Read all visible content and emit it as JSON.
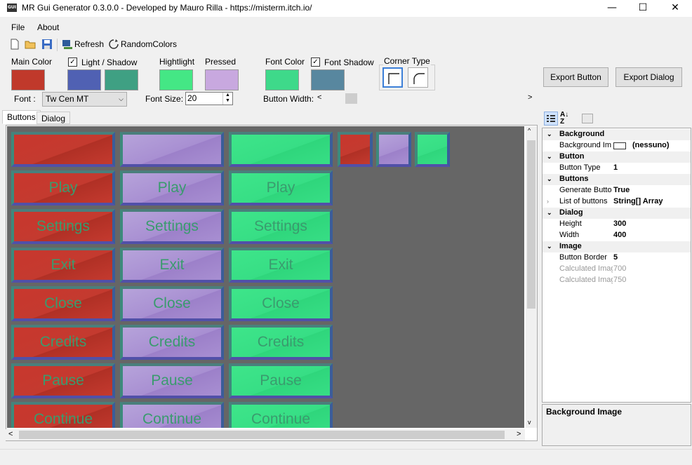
{
  "window": {
    "title": "MR Gui Generator 0.3.0.0 - Developed by Mauro Rilla - https://misterm.itch.io/",
    "app_icon_text": "GUI",
    "minimize": "—",
    "maximize": "☐",
    "close": "✕"
  },
  "menu": {
    "file": "File",
    "about": "About"
  },
  "toolbar": {
    "refresh": "Refresh",
    "random_colors": "RandomColors"
  },
  "options": {
    "main_color_label": "Main Color",
    "light_shadow_label": "Light / Shadow",
    "highlight_label": "Hightlight",
    "pressed_label": "Pressed",
    "font_color_label": "Font Color",
    "font_shadow_label": "Font Shadow",
    "corner_type_label": "Corner Type",
    "font_label": "Font :",
    "font_value": "Tw Cen MT",
    "font_size_label": "Font Size:",
    "font_size_value": "20",
    "button_width_label": "Button Width:",
    "export_button": "Export Button",
    "export_dialog": "Export Dialog",
    "colors": {
      "main": "#c0392b",
      "light": "#5061b3",
      "shadow": "#3fa083",
      "highlight": "#44e785",
      "pressed": "#c8a8df",
      "font": "#3ed98a",
      "font_shadow": "#58879f"
    }
  },
  "tabs": {
    "buttons": "Buttons",
    "dialog": "Dialog"
  },
  "canvas": {
    "labels": [
      "Play",
      "Settings",
      "Exit",
      "Close",
      "Credits",
      "Pause",
      "Continue"
    ]
  },
  "properties": {
    "categories": {
      "background": "Background",
      "button": "Button",
      "buttons": "Buttons",
      "dialog": "Dialog",
      "image": "Image"
    },
    "rows": {
      "background_image": {
        "name": "Background Im",
        "value": "(nessuno)"
      },
      "button_type": {
        "name": "Button Type",
        "value": "1"
      },
      "generate_button": {
        "name": "Generate Butto",
        "value": "True"
      },
      "list_of_buttons": {
        "name": "List of buttons",
        "value": "String[] Array"
      },
      "height": {
        "name": "Height",
        "value": "300"
      },
      "width": {
        "name": "Width",
        "value": "400"
      },
      "button_border": {
        "name": "Button Border",
        "value": "5"
      },
      "calc1": {
        "name": "Calculated Imag",
        "value": "700"
      },
      "calc2": {
        "name": "Calculated Imag",
        "value": "750"
      }
    },
    "description_title": "Background Image"
  }
}
